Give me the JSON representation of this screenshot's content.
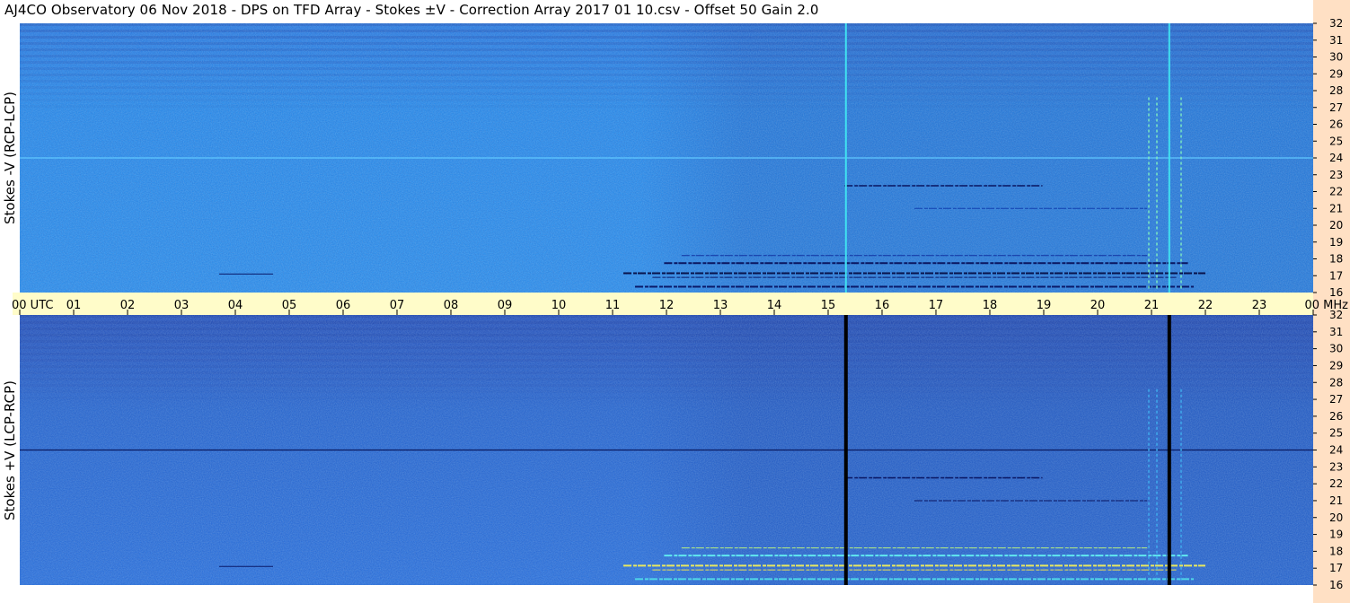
{
  "title": "AJ4CO Observatory  06 Nov 2018  -  DPS on TFD Array  -  Stokes ±V  -  Correction Array 2017 01 10.csv  -  Offset 50  Gain 2.0",
  "chart_data": [
    {
      "type": "heatmap",
      "panel": "upper",
      "ylabel": "Stokes -V (RCP-LCP)",
      "y_unit": "MHz",
      "y_range": [
        16,
        32
      ],
      "y_ticks": [
        "32",
        "31",
        "30",
        "29",
        "28",
        "27",
        "26",
        "25",
        "24",
        "23",
        "22",
        "21",
        "20",
        "19",
        "18",
        "17",
        "16"
      ],
      "x_range": [
        "00",
        "00"
      ],
      "colormap": [
        "#0a1a6a",
        "#1a3fb8",
        "#1e6ee0",
        "#1a9bf0",
        "#40d0e0",
        "#e8f060"
      ],
      "features": {
        "bright_vertical_lines_utc_hours": [
          15.33,
          21.33
        ],
        "horizontal_line_mhz": 24.0,
        "activity_band_mhz": [
          16,
          18.5
        ],
        "activity_start_utc_hour": 11.2,
        "activity_end_utc_hour": 22.0
      }
    },
    {
      "type": "heatmap",
      "panel": "lower",
      "ylabel": "Stokes +V (LCP-RCP)",
      "y_unit": "MHz",
      "y_range": [
        16,
        32
      ],
      "y_ticks": [
        "32",
        "31",
        "30",
        "29",
        "28",
        "27",
        "26",
        "25",
        "24",
        "23",
        "22",
        "21",
        "20",
        "19",
        "18",
        "17",
        "16"
      ],
      "x_range": [
        "00",
        "00"
      ],
      "colormap": [
        "#0a1a6a",
        "#1a3fb8",
        "#1e6ee0",
        "#1a9bf0",
        "#40d0e0",
        "#e8f060"
      ],
      "features": {
        "dark_vertical_lines_utc_hours": [
          15.33,
          21.33
        ],
        "horizontal_line_mhz": 24.0,
        "activity_band_mhz": [
          16,
          18.5
        ],
        "activity_start_utc_hour": 11.2,
        "activity_end_utc_hour": 22.0
      }
    }
  ],
  "time_axis": {
    "labels": [
      "00 UTC",
      "01",
      "02",
      "03",
      "04",
      "05",
      "06",
      "07",
      "08",
      "09",
      "10",
      "11",
      "12",
      "13",
      "14",
      "15",
      "16",
      "17",
      "18",
      "19",
      "20",
      "21",
      "22",
      "23",
      "00 MHz"
    ],
    "unit_left": "UTC",
    "unit_right": "MHz"
  }
}
